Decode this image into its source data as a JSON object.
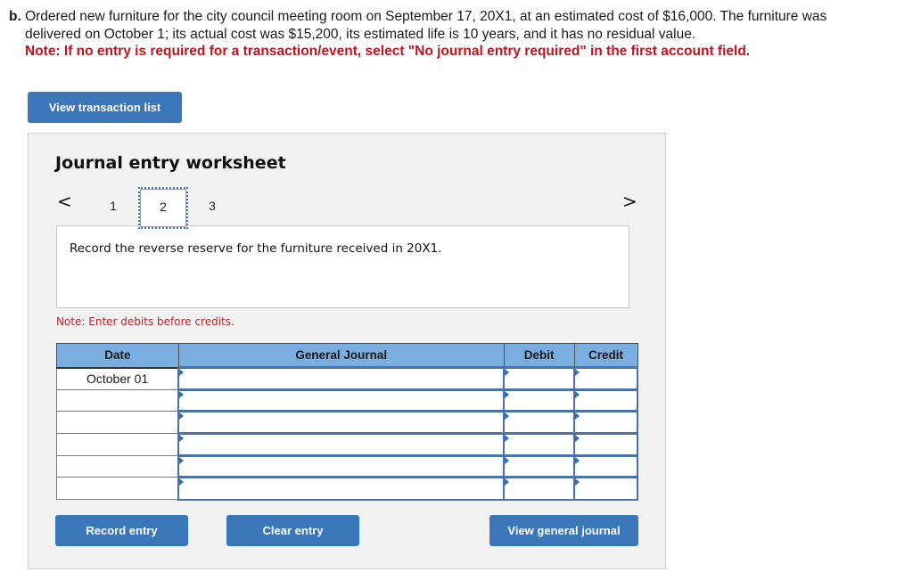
{
  "problem": {
    "letter": "b.",
    "line1": "Ordered new furniture for the city council meeting room on September 17, 20X1, at an estimated cost of $16,000. The furniture was",
    "line2": "delivered on October 1; its actual cost was $15,200, its estimated life is 10 years, and it has no residual value.",
    "note": "Note: If no entry is required for a transaction/event, select \"No journal entry required\" in the first account field."
  },
  "buttons": {
    "view_transaction_list": "View transaction list",
    "record_entry": "Record entry",
    "clear_entry": "Clear entry",
    "view_general_journal": "View general journal"
  },
  "worksheet": {
    "title": "Journal entry worksheet",
    "prev_icon": "chevron-left-icon",
    "next_icon": "chevron-right-icon",
    "prev_glyph": "<",
    "next_glyph": ">",
    "pages": [
      "1",
      "2",
      "3"
    ],
    "current_page": "2",
    "instruction": "Record the reverse reserve for the furniture received in 20X1.",
    "note": "Note: Enter debits before credits."
  },
  "journal": {
    "headers": {
      "date": "Date",
      "general_journal": "General Journal",
      "debit": "Debit",
      "credit": "Credit"
    },
    "rows": [
      {
        "date": "October 01",
        "account": "",
        "debit": "",
        "credit": ""
      },
      {
        "date": "",
        "account": "",
        "debit": "",
        "credit": ""
      },
      {
        "date": "",
        "account": "",
        "debit": "",
        "credit": ""
      },
      {
        "date": "",
        "account": "",
        "debit": "",
        "credit": ""
      },
      {
        "date": "",
        "account": "",
        "debit": "",
        "credit": ""
      },
      {
        "date": "",
        "account": "",
        "debit": "",
        "credit": ""
      }
    ]
  },
  "colors": {
    "button_blue": "#3a76b8",
    "header_blue": "#7aaee0",
    "note_red": "#c1121f",
    "panel_bg": "#f2f2f2"
  }
}
